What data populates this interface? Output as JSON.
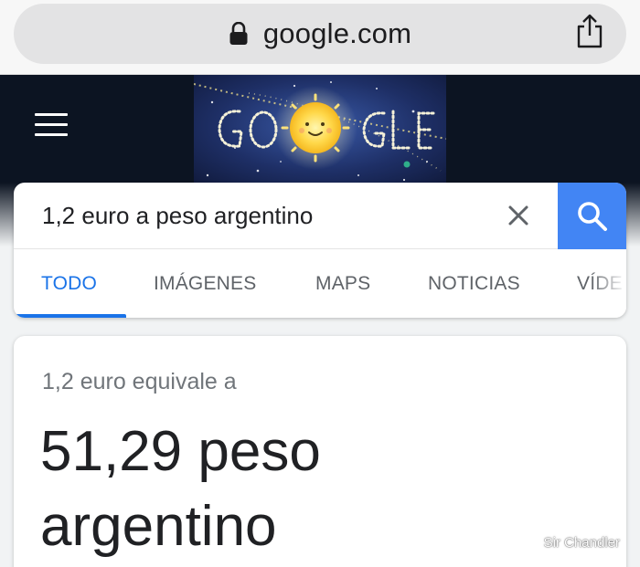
{
  "browser": {
    "url": "google.com"
  },
  "search": {
    "query": "1,2 euro a peso argentino"
  },
  "tabs": [
    {
      "label": "TODO",
      "active": true
    },
    {
      "label": "IMÁGENES",
      "active": false
    },
    {
      "label": "MAPS",
      "active": false
    },
    {
      "label": "NOTICIAS",
      "active": false
    },
    {
      "label": "VÍDE",
      "active": false
    }
  ],
  "result": {
    "subtitle": "1,2 euro equivale a",
    "value_line": "51,29 peso",
    "unit_line": "argentino"
  },
  "watermark": "Sir Chandler",
  "doodle": {
    "letters": "GOOGLE"
  },
  "colors": {
    "accent": "#1a73e8",
    "search_button": "#4285f4",
    "header_bg": "#0c1422"
  },
  "icons": {
    "lock": "lock-icon",
    "share": "share-icon",
    "menu": "menu-icon",
    "clear": "close-icon",
    "search": "search-icon"
  }
}
